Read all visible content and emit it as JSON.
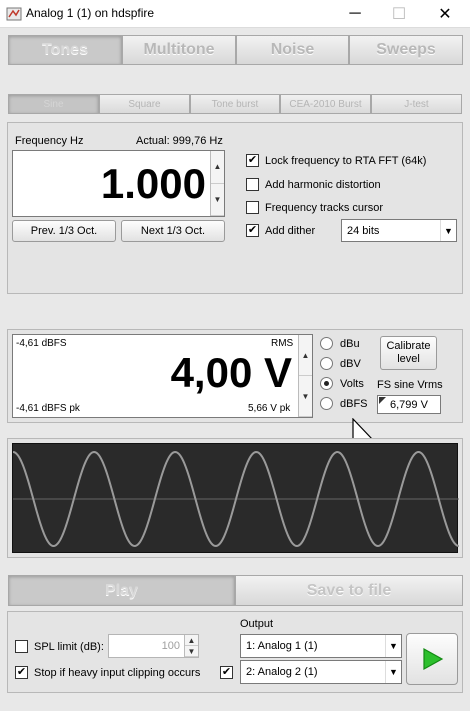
{
  "window": {
    "title": "Analog 1 (1) on hdspfire",
    "minimize": "─",
    "maximize": "☐",
    "close": "✕"
  },
  "main_tabs": [
    "Tones",
    "Multitone",
    "Noise",
    "Sweeps"
  ],
  "sub_tabs": [
    "Sine",
    "Square",
    "Tone burst",
    "CEA-2010 Burst",
    "J-test"
  ],
  "frequency": {
    "label": "Frequency Hz",
    "actual": "Actual: 999,76 Hz",
    "value": "1.000",
    "prev_button": "Prev. 1/3 Oct.",
    "next_button": "Next 1/3 Oct."
  },
  "options": {
    "lock": {
      "label": "Lock frequency to RTA FFT (64k)",
      "checked": "✔"
    },
    "harmonic": {
      "label": "Add harmonic distortion",
      "checked": ""
    },
    "tracks": {
      "label": "Frequency tracks cursor",
      "checked": ""
    },
    "dither": {
      "label": "Add dither",
      "checked": "✔"
    },
    "bits": "24 bits"
  },
  "level": {
    "top_left": "-4,61 dBFS",
    "top_right": "RMS",
    "value": "4,00 V",
    "bottom_left": "-4,61 dBFS pk",
    "bottom_right": "5,66 V pk",
    "units": [
      "dBu",
      "dBV",
      "Volts",
      "dBFS"
    ],
    "selected_unit": "Volts",
    "calibrate_line1": "Calibrate",
    "calibrate_line2": "level",
    "fs_label": "FS sine Vrms",
    "fs_value": "6,799 V"
  },
  "waveform": {
    "cycles": 5.5,
    "background": "#2a2a2a",
    "line_color": "#9a9a9a"
  },
  "actions": {
    "play": "Play",
    "save": "Save to file"
  },
  "bottom": {
    "spl_label": "SPL limit (dB):",
    "spl_checked": "",
    "spl_value": "100",
    "stop_label": "Stop if heavy input clipping occurs",
    "stop_checked": "✔",
    "output_label": "Output",
    "output1": "1: Analog 1 (1)",
    "output2_checked": "✔",
    "output2": "2: Analog 2 (1)"
  },
  "colors": {
    "play_green": "#2dbf2d"
  }
}
